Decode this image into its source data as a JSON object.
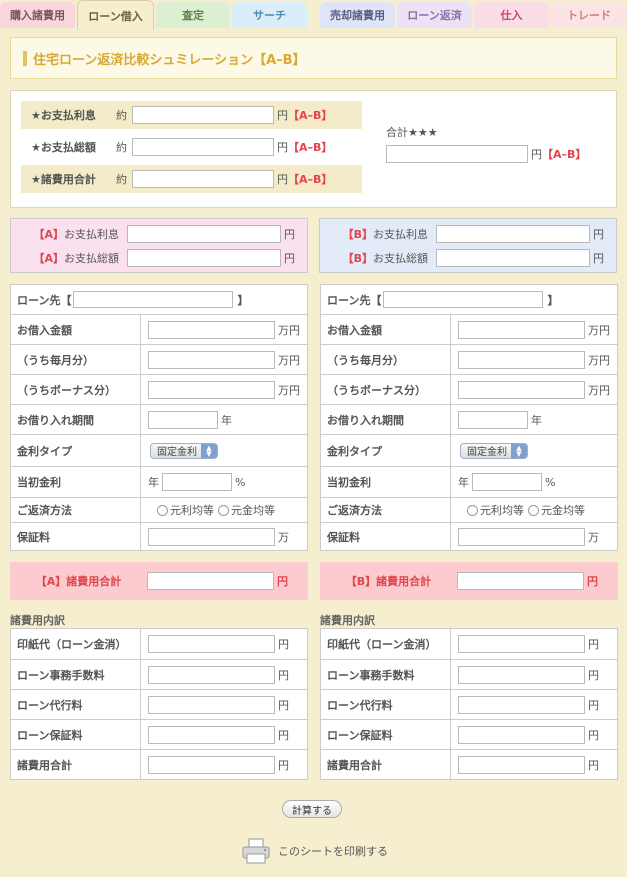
{
  "tabs": [
    {
      "label": "購入諸費用",
      "bg": "#f9d6dc",
      "color": "#7a5560"
    },
    {
      "label": "ローン借入",
      "bg": "#f6efcf",
      "color": "#6b5e34"
    },
    {
      "label": "査定",
      "bg": "#dcefd3",
      "color": "#5b8650"
    },
    {
      "label": "サーチ",
      "bg": "#d9eef8",
      "color": "#4c8bb2"
    },
    {
      "label": "売却諸費用",
      "bg": "#dfe4f6",
      "color": "#5a5f88"
    },
    {
      "label": "ローン返済",
      "bg": "#ece2f6",
      "color": "#8b6fac"
    },
    {
      "label": "仕入",
      "bg": "#fbdde5",
      "color": "#c44970"
    },
    {
      "label": "トレード",
      "bg": "#fbe4e4",
      "color": "#c97f7f"
    }
  ],
  "title": "住宅ローン返済比較シュミレーション【A–B】",
  "summary": {
    "rows": [
      {
        "label": "★お支払利息",
        "prefix": "約",
        "unit": "円",
        "tag": "【A–B】"
      },
      {
        "label": "★お支払総額",
        "prefix": "約",
        "unit": "円",
        "tag": "【A–B】"
      },
      {
        "label": "★諸費用合計",
        "prefix": "約",
        "unit": "円",
        "tag": "【A–B】"
      }
    ],
    "total_label": "合計★★★",
    "total_unit": "円",
    "total_tag": "【A–B】"
  },
  "compare": {
    "a": {
      "rows": [
        {
          "tag": "【A】",
          "label": "お支払利息",
          "unit": "円"
        },
        {
          "tag": "【A】",
          "label": "お支払総額",
          "unit": "円"
        }
      ]
    },
    "b": {
      "rows": [
        {
          "tag": "【B】",
          "label": "お支払利息",
          "unit": "円"
        },
        {
          "tag": "【B】",
          "label": "お支払総額",
          "unit": "円"
        }
      ]
    }
  },
  "loan": {
    "lender_label": "ローン先【",
    "lender_close": "】",
    "borrow_amount": "お借入金額",
    "monthly_part": "（うち毎月分）",
    "bonus_part": "（うちボーナス分）",
    "man_yen": "万円",
    "period": "お借り入れ期間",
    "year": "年",
    "rate_type": "金利タイプ",
    "rate_type_value": "固定金利",
    "initial_rate": "当初金利",
    "rate_prefix": "年",
    "percent": "%",
    "repay_method": "ご返済方法",
    "repay_opt1": "元利均等",
    "repay_opt2": "元金均等",
    "guarantee": "保証料",
    "man": "万"
  },
  "costs": {
    "a_label": "【A】諸費用合計",
    "b_label": "【B】諸費用合計",
    "unit": "円",
    "section_title": "諸費用内訳",
    "items": [
      "印紙代（ローン金消）",
      "ローン事務手数料",
      "ローン代行料",
      "ローン保証料",
      "諸費用合計"
    ]
  },
  "calc_button": "計算する",
  "print_label": "このシートを印刷する"
}
